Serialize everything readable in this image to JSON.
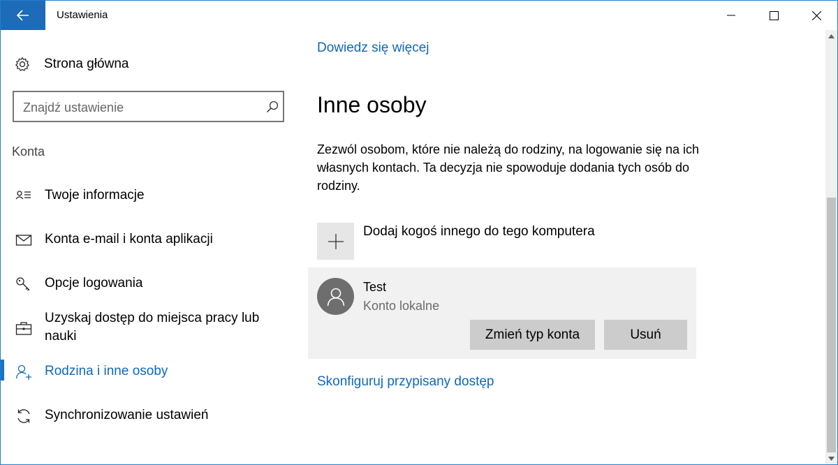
{
  "window": {
    "title": "Ustawienia",
    "accent": "#1e6bb8",
    "link_color": "#1068b8"
  },
  "sidebar": {
    "home_label": "Strona główna",
    "search": {
      "placeholder": "Znajdź ustawienie"
    },
    "section_label": "Konta",
    "items": [
      {
        "label": "Twoje informacje",
        "icon": "person-card-icon",
        "active": false
      },
      {
        "label": "Konta e-mail i konta aplikacji",
        "icon": "mail-icon",
        "active": false
      },
      {
        "label": "Opcje logowania",
        "icon": "key-icon",
        "active": false
      },
      {
        "label": "Uzyskaj dostęp do miejsca pracy lub nauki",
        "icon": "briefcase-icon",
        "active": false
      },
      {
        "label": "Rodzina i inne osoby",
        "icon": "person-add-icon",
        "active": true
      },
      {
        "label": "Synchronizowanie ustawień",
        "icon": "sync-icon",
        "active": false
      }
    ]
  },
  "main": {
    "learn_more_link": "Dowiedz się więcej",
    "heading": "Inne osoby",
    "description": "Zezwól osobom, które nie należą do rodziny, na logowanie się na ich własnych kontach. Ta decyzja nie spowoduje dodania tych osób do rodziny.",
    "add_person_label": "Dodaj kogoś innego do tego komputera",
    "user": {
      "name": "Test",
      "type": "Konto lokalne",
      "change_button": "Zmień typ konta",
      "remove_button": "Usuń"
    },
    "assigned_access_link": "Skonfiguruj przypisany dostęp"
  }
}
